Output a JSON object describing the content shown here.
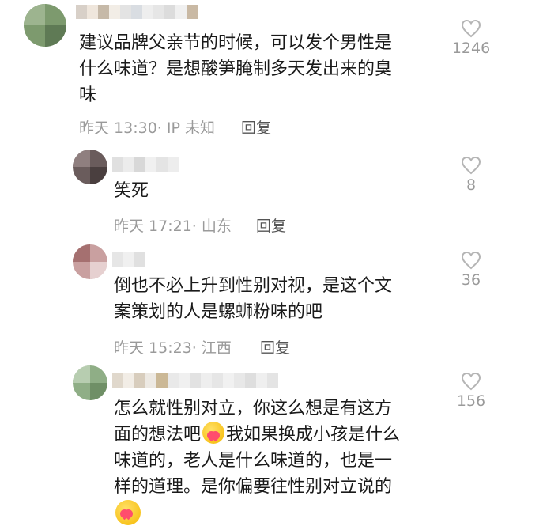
{
  "comments": [
    {
      "text": "建议品牌父亲节的时候，可以发个男性是什么味道？是想酸笋腌制多天发出来的臭味",
      "lines": [
        "建议品牌父亲节的时候，可以发个男性是",
        "什么味道？是想酸笋腌制多天发出来的臭",
        "味"
      ],
      "time": "昨天 13:30",
      "location": "· IP 未知",
      "reply_label": "回复",
      "likes": "1246"
    },
    {
      "text": "笑死",
      "lines": [
        "笑死"
      ],
      "time": "昨天 17:21",
      "location": "· 山东",
      "reply_label": "回复",
      "likes": "8"
    },
    {
      "text": "倒也不必上升到性别对视，是这个文案策划的人是螺蛳粉味的吧",
      "lines": [
        "倒也不必上升到性别对视，是这个文",
        "案策划的人是螺蛳粉味的吧"
      ],
      "time": "昨天 15:23",
      "location": "· 江西",
      "reply_label": "回复",
      "likes": "36"
    },
    {
      "text": "怎么就性别对立，你这么想是有这方面的想法吧🥰我如果换成小孩是什么味道的，老人是什么味道的，也是一样的道理。是你偏要往性别对立说的🥰",
      "line1": "怎么就性别对立，你这么想是有这方",
      "line2a": "面的想法吧",
      "line2b": "我如果换成小孩是什么",
      "line3": "味道的，老人是什么味道的，也是一",
      "line4": "样的道理。是你偏要往性别对立说的",
      "likes": "156"
    }
  ],
  "icons": {
    "like": "heart-outline-icon",
    "emoji": "heart-face-emoji"
  },
  "colors": {
    "meta": "#9a9a9a",
    "text": "#1a1a1a",
    "reply": "#555555"
  }
}
